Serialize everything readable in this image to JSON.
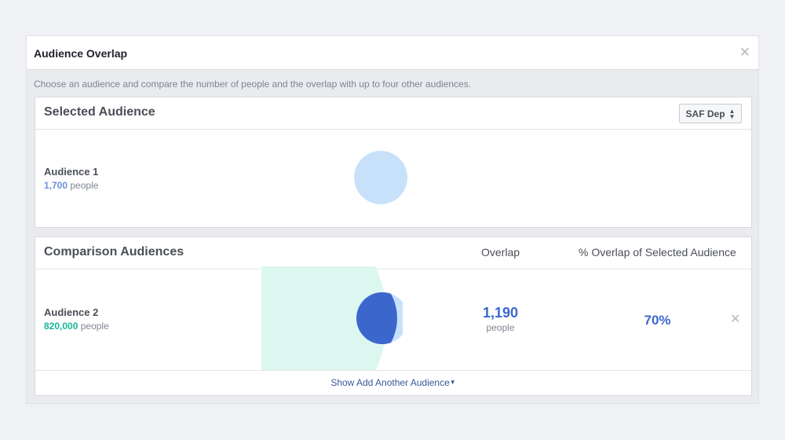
{
  "dialog": {
    "title": "Audience Overlap",
    "close_icon": "close-icon",
    "instructions": "Choose an audience and compare the number of people and the overlap with up to four other audiences."
  },
  "selected_audience": {
    "title": "Selected Audience",
    "selector_value": "SAF Dep",
    "audience": {
      "name": "Audience 1",
      "size": "1,700",
      "unit": "people"
    }
  },
  "comparison": {
    "title": "Comparison Audiences",
    "col_overlap": "Overlap",
    "col_pct": "% Overlap of Selected Audience",
    "rows": [
      {
        "name": "Audience 2",
        "size": "820,000",
        "unit": "people",
        "overlap": "1,190",
        "overlap_unit": "people",
        "pct": "70%"
      }
    ],
    "footer_link": "Show Add Another Audience"
  },
  "colors": {
    "selected_circle": "#c8e1fb",
    "comparison_fill": "#dcf7ef",
    "overlap_fill": "#3b67cd",
    "accent_blue": "#3b67cd",
    "accent_green": "#16b59b"
  }
}
